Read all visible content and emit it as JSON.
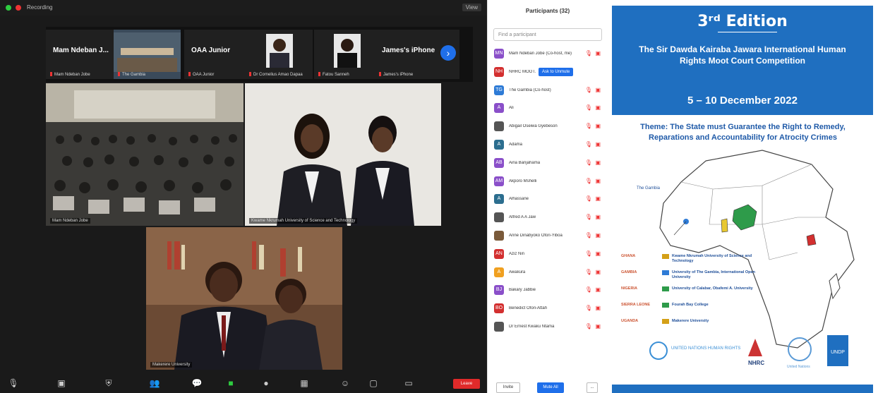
{
  "zoom": {
    "titlebar": {
      "recording_label": "Recording",
      "view_label": "View"
    },
    "strip": [
      {
        "name": "Mam Ndeban J...",
        "sub": "Mam Ndeban Jobe"
      },
      {
        "name": "",
        "sub": "The Gambia"
      },
      {
        "name": "OAA Junior",
        "sub": "OAA Junior"
      },
      {
        "name": "",
        "sub": "Dr Cornelius Amao Dapaa"
      },
      {
        "name": "",
        "sub": "Fatou Sanneh"
      },
      {
        "name": "James's iPhone",
        "sub": "James's iPhone"
      }
    ],
    "tiles": [
      {
        "label": "Mam Ndeban Jobe"
      },
      {
        "label": "Kwame Nkrumah University of Science and Technology"
      },
      {
        "label": "Makerere University"
      }
    ],
    "leave_label": "Leave"
  },
  "panel": {
    "title": "Participants (32)",
    "search_placeholder": "Find a participant",
    "admit_label": "Ask to Unmute",
    "participants": [
      {
        "name": "Mam Ndeban Jobe (Co-host, me)",
        "initials": "MN",
        "color": "#8a4fc9"
      },
      {
        "name": "NHRC MOOT...",
        "initials": "NH",
        "color": "#d32f2f"
      },
      {
        "name": "The Gambia (Co-host)",
        "initials": "TG",
        "color": "#2e7bd6"
      },
      {
        "name": "Ali",
        "initials": "A",
        "color": "#8a4fc9"
      },
      {
        "name": "Abigail Oseiwa Gyebeson",
        "initials": "",
        "color": "#555555"
      },
      {
        "name": "Adama",
        "initials": "A",
        "color": "#2c6e8f"
      },
      {
        "name": "Aina Banjahama",
        "initials": "AB",
        "color": "#8a4fc9"
      },
      {
        "name": "Akporo Mshelli",
        "initials": "AM",
        "color": "#8a4fc9"
      },
      {
        "name": "Alhassane",
        "initials": "A",
        "color": "#2c6e8f"
      },
      {
        "name": "Alfred A A Jaw",
        "initials": "",
        "color": "#555555"
      },
      {
        "name": "Anne Dinabyoko Ofori-Yiboa",
        "initials": "",
        "color": "#7a5a3a"
      },
      {
        "name": "Aziz Nin",
        "initials": "AN",
        "color": "#d32f2f"
      },
      {
        "name": "Awakura",
        "initials": "A",
        "color": "#f0a020"
      },
      {
        "name": "Bakary Jabbie",
        "initials": "BJ",
        "color": "#8a4fc9"
      },
      {
        "name": "Benedict Ofori-Attah",
        "initials": "BO",
        "color": "#d32f2f"
      },
      {
        "name": "Dr Ernest Kwaku Ntama",
        "initials": "",
        "color": "#555555"
      }
    ],
    "footer": {
      "invite": "Invite",
      "mute_all": "Mute All",
      "more": "..."
    }
  },
  "poster": {
    "edition": "3ʳᵈ Edition",
    "competition": "The Sir Dawda Kairaba Jawara International Human Rights Moot Court Competition",
    "dates": "5 – 10 December 2022",
    "theme": "Theme: The State must Guarantee the Right to Remedy, Reparations and Accountability for Atrocity Crimes",
    "map_label": "The Gambia",
    "universities": [
      {
        "country": "GHANA",
        "uni": "Kwame Nkrumah University of Science and Technology",
        "flag": "#d4a017"
      },
      {
        "country": "GAMBIA",
        "uni": "University of The Gambia, International Open University",
        "flag": "#2e7bd6"
      },
      {
        "country": "NIGERIA",
        "uni": "University of Calabar, Obafemi A. University",
        "flag": "#2e9b4a"
      },
      {
        "country": "SIERRA LEONE",
        "uni": "Fourah Bay College",
        "flag": "#2e9b4a"
      },
      {
        "country": "UGANDA",
        "uni": "Makerere University",
        "flag": "#d4a017"
      }
    ],
    "logos": [
      "UNITED NATIONS HUMAN RIGHTS",
      "NHRC",
      "United Nations",
      "UNDP"
    ]
  }
}
